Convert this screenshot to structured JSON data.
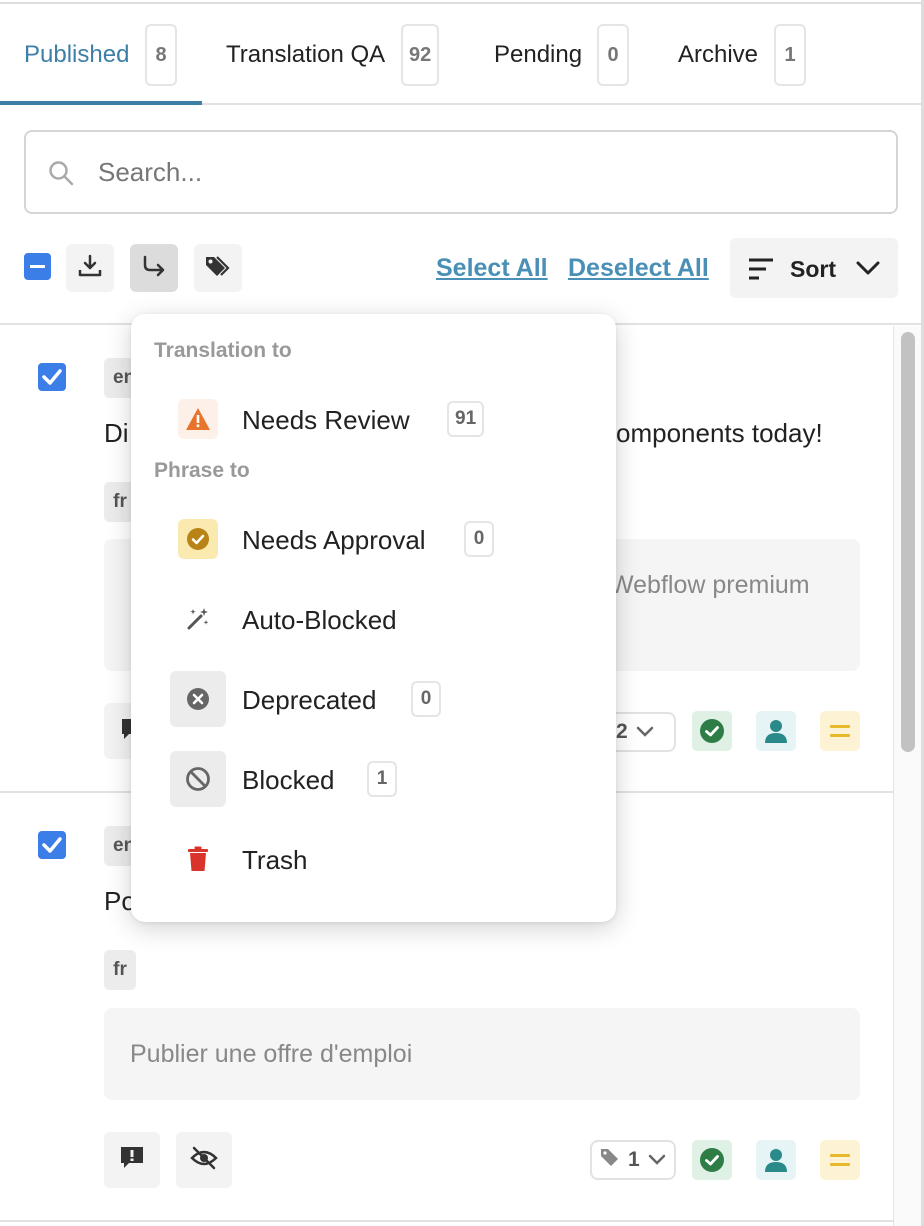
{
  "tabs": [
    {
      "label": "Published",
      "count": "8"
    },
    {
      "label": "Translation QA",
      "count": "92"
    },
    {
      "label": "Pending",
      "count": "0"
    },
    {
      "label": "Archive",
      "count": "1"
    }
  ],
  "search": {
    "placeholder": "Search..."
  },
  "toolbar": {
    "select_all": "Select All",
    "deselect_all": "Deselect All",
    "sort_label": "Sort"
  },
  "items": [
    {
      "source_lang": "en",
      "source_text_start": "Di",
      "source_text_end": "omponents today!",
      "target_lang": "fr",
      "translation_visible": "Webflow premium",
      "tag_count": "2"
    },
    {
      "source_lang": "en",
      "source_text_start": "Po",
      "target_lang": "fr",
      "translation_visible": "Publier une offre d'emploi",
      "tag_count": "1"
    }
  ],
  "menu": {
    "translation_header": "Translation to",
    "phrase_header": "Phrase to",
    "options": [
      {
        "label": "Needs Review",
        "count": "91",
        "icon": "warning-icon",
        "color": "#e8742b"
      },
      {
        "label": "Needs Approval",
        "count": "0",
        "icon": "approval-icon",
        "color": "#b98316"
      },
      {
        "label": "Auto-Blocked",
        "count": "",
        "icon": "magic-wand-icon",
        "color": "#555555"
      },
      {
        "label": "Deprecated",
        "count": "0",
        "icon": "x-circle-icon",
        "color": "#666666"
      },
      {
        "label": "Blocked",
        "count": "1",
        "icon": "block-icon",
        "color": "#666666"
      },
      {
        "label": "Trash",
        "count": "",
        "icon": "trash-icon",
        "color": "#d9342b"
      }
    ]
  },
  "colors": {
    "accent": "#3d7fa6",
    "checkbox": "#3b7ee8",
    "status_green": "#2e8b4e",
    "status_teal": "#2a8a8a",
    "status_yellow": "#e8b92b"
  }
}
